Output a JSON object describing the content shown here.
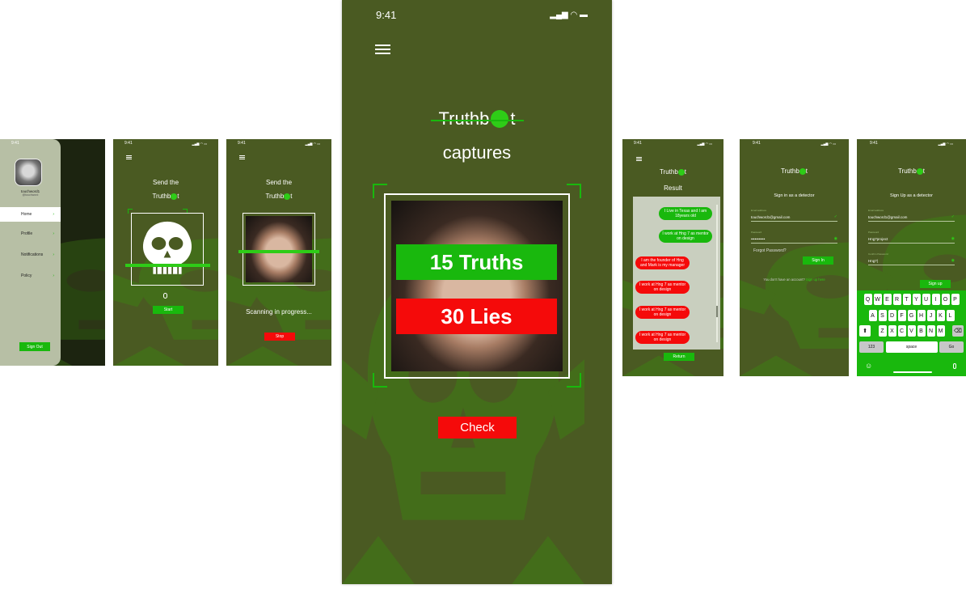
{
  "status": {
    "time": "9:41"
  },
  "brand": {
    "logo_left": "Truthb",
    "logo_right": "t",
    "accent": "#19b80d",
    "lie_color": "#f50a0a",
    "bg": "#4a5a22"
  },
  "menu_screen": {
    "profile_name": "touchword1",
    "profile_handle": "@touchword",
    "items": [
      "Home",
      "Profile",
      "Notifications",
      "Policy"
    ],
    "signout": "Sign Out"
  },
  "send_screen": {
    "title": "Send the",
    "start": "Start"
  },
  "scan_screen": {
    "title": "Send the",
    "progress": "Scanning in progress...",
    "stop": "Stop"
  },
  "main": {
    "subtitle": "captures",
    "truths": "15 Truths",
    "lies": "30 Lies",
    "check": "Check"
  },
  "result_screen": {
    "title": "Result",
    "messages": [
      {
        "side": "right",
        "text": "I Live in Texas and I am 18years old",
        "color": "green"
      },
      {
        "side": "right",
        "text": "I work at Hng 7 as mentor on design",
        "color": "green"
      },
      {
        "side": "left",
        "text": "I am the founder of Hng and Mark is my manager",
        "color": "red"
      },
      {
        "side": "left",
        "text": "I work at Hng 7 as mentor on design",
        "color": "red"
      },
      {
        "side": "left",
        "text": "I work at Hng 7 as mentor on design",
        "color": "red"
      },
      {
        "side": "left",
        "text": "I work at Hng 7 as mentor on design",
        "color": "red"
      }
    ],
    "return": "Return"
  },
  "signin_screen": {
    "heading": "Sign in as a detector",
    "email_label": "Email address",
    "email": "touchword1@gmail.com",
    "password_label": "Password",
    "password": "•••••••••••",
    "forgot": "Forgot Password?",
    "signin": "Sign In",
    "no_account": "You don't have an account?",
    "signup_link": "Sign up here"
  },
  "signup_screen": {
    "heading": "Sign Up as a detector",
    "email_label": "Email address",
    "email": "touchword1@gmail.com",
    "password_label": "Password",
    "password": "Hng7project",
    "confirm_label": "Confirm Password",
    "confirm": "Hng7|",
    "signup": "Sign up",
    "keyboard": {
      "row1": [
        "Q",
        "W",
        "E",
        "R",
        "T",
        "Y",
        "U",
        "I",
        "O",
        "P"
      ],
      "row2": [
        "A",
        "S",
        "D",
        "F",
        "G",
        "H",
        "J",
        "K",
        "L"
      ],
      "row3": [
        "Z",
        "X",
        "C",
        "V",
        "B",
        "N",
        "M"
      ],
      "num": "123",
      "space": "space",
      "go": "Go"
    }
  }
}
